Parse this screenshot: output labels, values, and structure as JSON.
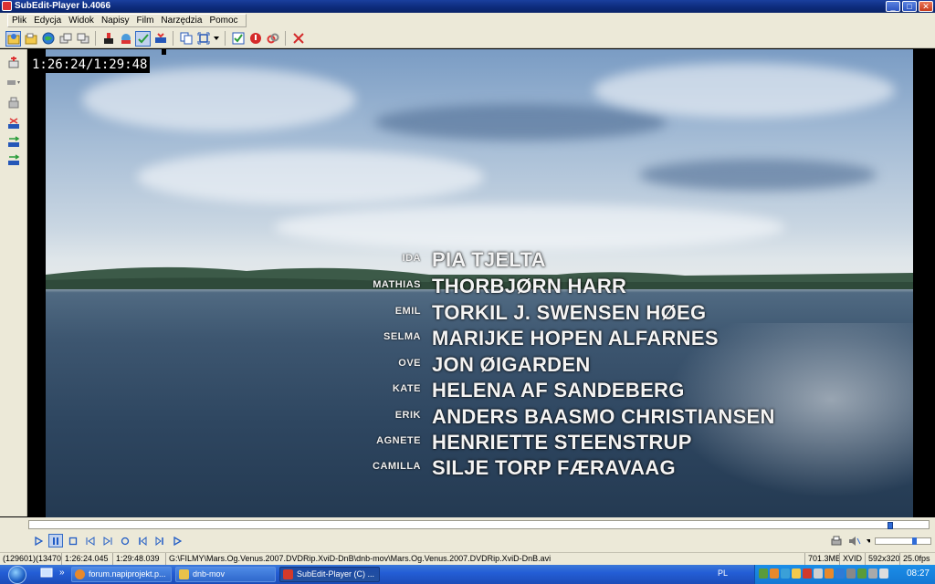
{
  "window": {
    "title": "SubEdit-Player  b.4066",
    "controls": [
      "_",
      "□",
      "✕"
    ]
  },
  "menu": [
    "Plik",
    "Edycja",
    "Widok",
    "Napisy",
    "Film",
    "Narzędzia",
    "Pomoc"
  ],
  "player": {
    "timecode": "1:26:24/1:29:48",
    "credits": [
      {
        "role": "IDA",
        "actor": "PIA TJELTA"
      },
      {
        "role": "MATHIAS",
        "actor": "THORBJØRN HARR"
      },
      {
        "role": "EMIL",
        "actor": "TORKIL J. SWENSEN HØEG"
      },
      {
        "role": "SELMA",
        "actor": "MARIJKE HOPEN ALFARNES"
      },
      {
        "role": "OVE",
        "actor": "JON ØIGARDEN"
      },
      {
        "role": "KATE",
        "actor": "HELENA AF SANDEBERG"
      },
      {
        "role": "ERIK",
        "actor": "ANDERS BAASMO CHRISTIANSEN"
      },
      {
        "role": "AGNETE",
        "actor": "HENRIETTE STEENSTRUP"
      },
      {
        "role": "CAMILLA",
        "actor": "SILJE TORP FÆRAVAAG"
      }
    ],
    "seek_position": 0.962,
    "volume_level": 0.72
  },
  "status": {
    "frames": "(129601)(134701)",
    "current_time": "1:26:24.045",
    "total_time": "1:29:48.039",
    "file_path": "G:\\FILMY\\Mars.Og.Venus.2007.DVDRip.XviD-DnB\\dnb-mov\\Mars.Og.Venus.2007.DVDRip.XviD-DnB.avi",
    "file_size": "701.3MB",
    "codec": "XVID",
    "resolution": "592x320",
    "fps": "25.0fps"
  },
  "taskbar": {
    "tasks": [
      {
        "label": "forum.napiprojekt.p...",
        "icon_color": "#e8892b"
      },
      {
        "label": "dnb-mov",
        "icon_color": "#e8c24a"
      },
      {
        "label": "SubEdit-Player (C) ...",
        "icon_color": "#d33a2a"
      }
    ],
    "language": "PL",
    "clock": "08:27",
    "quicklaunch_more": "»"
  }
}
